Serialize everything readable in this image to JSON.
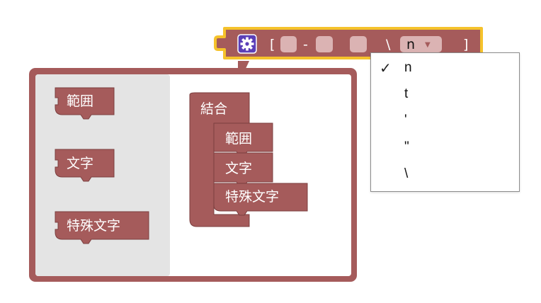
{
  "colors": {
    "block": "#a55b5b",
    "block_dark": "#7c3f3f",
    "field_light": "#dbb3b3",
    "highlight": "#f5c22b",
    "gear_bg": "#5b3fb8",
    "flyout_bg": "#e4e4e4"
  },
  "top_block": {
    "gear_icon": "gear-icon",
    "open_bracket": "[",
    "dash": "-",
    "backslash": "\\",
    "dropdown_value": "n",
    "dropdown_arrow": "▼",
    "close_bracket": "]"
  },
  "flyout": {
    "blocks": [
      "範囲",
      "文字",
      "特殊文字"
    ]
  },
  "join_block": {
    "label": "結合",
    "items": [
      "範囲",
      "文字",
      "特殊文字"
    ]
  },
  "dropdown": {
    "options": [
      {
        "label": "n",
        "checked": true
      },
      {
        "label": "t",
        "checked": false
      },
      {
        "label": "'",
        "checked": false
      },
      {
        "label": "\"",
        "checked": false
      },
      {
        "label": "\\",
        "checked": false
      }
    ],
    "check_mark": "✓"
  }
}
